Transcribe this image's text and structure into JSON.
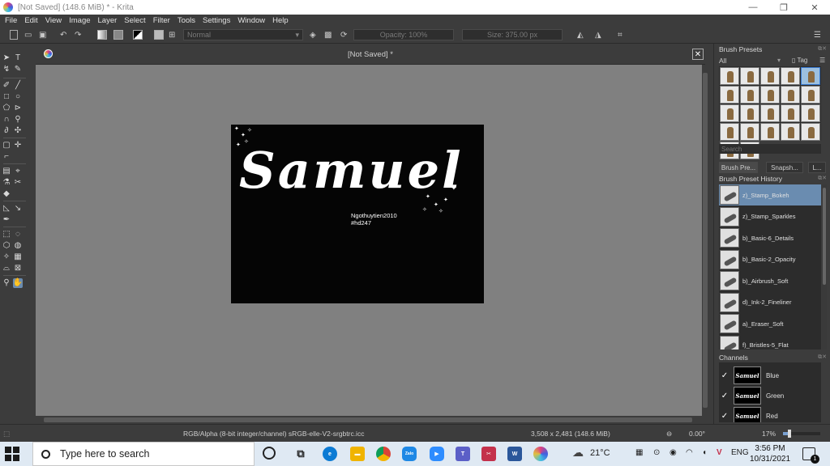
{
  "window": {
    "title": "[Not Saved]  (148.6 MiB)  * - Krita",
    "controls": {
      "minimize": "—",
      "maximize": "❐",
      "close": "✕"
    }
  },
  "menu": [
    "File",
    "Edit",
    "View",
    "Image",
    "Layer",
    "Select",
    "Filter",
    "Tools",
    "Settings",
    "Window",
    "Help"
  ],
  "toolbar": {
    "blend_mode": "Normal",
    "opacity": "Opacity: 100%",
    "size": "Size: 375.00 px"
  },
  "document": {
    "tab_title": "[Not Saved]  *",
    "artwork_text": "Samuel",
    "credit_line1": "Ngothuytien2010",
    "credit_line2": "#hd247"
  },
  "brush_presets": {
    "title": "Brush Presets",
    "filter": "All",
    "tag_label": "Tag",
    "search_placeholder": "Search",
    "thumbnail_count": 22
  },
  "docker_tabs": [
    "Brush Pre...",
    "Snapsh...",
    "L..."
  ],
  "preset_history": {
    "title": "Brush Preset History",
    "items": [
      {
        "label": "z)_Stamp_Bokeh",
        "selected": true
      },
      {
        "label": "z)_Stamp_Sparkles",
        "selected": false
      },
      {
        "label": "b)_Basic-6_Details",
        "selected": false
      },
      {
        "label": "b)_Basic-2_Opacity",
        "selected": false
      },
      {
        "label": "b)_Airbrush_Soft",
        "selected": false
      },
      {
        "label": "d)_Ink-2_Fineliner",
        "selected": false
      },
      {
        "label": "a)_Eraser_Soft",
        "selected": false
      },
      {
        "label": "f)_Bristles-5_Flat",
        "selected": false
      }
    ]
  },
  "channels": {
    "title": "Channels",
    "items": [
      {
        "label": "Blue",
        "checked": true
      },
      {
        "label": "Green",
        "checked": true
      },
      {
        "label": "Red",
        "checked": true
      }
    ]
  },
  "status": {
    "color_profile": "RGB/Alpha (8-bit integer/channel)  sRGB-elle-V2-srgbtrc.icc",
    "dimensions": "3,508 x 2,481 (148.6 MiB)",
    "rotation": "0.00°",
    "zoom": "17%",
    "zoom_fraction": 0.17
  },
  "taskbar": {
    "search_placeholder": "Type here to search",
    "weather": "21°C",
    "language": "ENG",
    "time": "3:56 PM",
    "date": "10/31/2021",
    "notification_count": "1"
  },
  "colors": {
    "ui_bg": "#3c3c3c",
    "canvas_bg": "#808080",
    "artwork_bg": "#050505",
    "selection": "#6a8cb0",
    "taskbar": "#dfe9f3"
  }
}
